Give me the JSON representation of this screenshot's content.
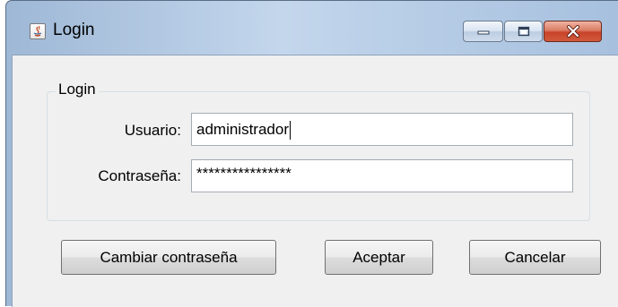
{
  "window": {
    "title": "Login",
    "icon": "java-icon"
  },
  "caption_buttons": [
    "minimize-icon",
    "maximize-icon",
    "close-icon"
  ],
  "form": {
    "group_label": "Login",
    "username_label": "Usuario:",
    "username_value": "administrador",
    "password_label": "Contraseña:",
    "password_value": "****************"
  },
  "buttons": {
    "change_password": "Cambiar contraseña",
    "accept": "Aceptar",
    "cancel": "Cancelar"
  }
}
